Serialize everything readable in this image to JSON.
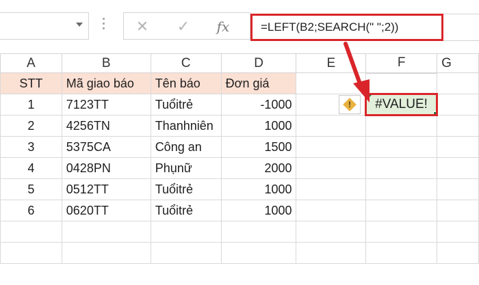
{
  "formula_bar": {
    "name_box_value": "",
    "cancel_icon": "✕",
    "enter_icon": "✓",
    "insert_function_label": "fx",
    "formula": "=LEFT(B2;SEARCH(\" \";2))"
  },
  "columns": [
    "A",
    "B",
    "C",
    "D",
    "E",
    "F",
    "G"
  ],
  "header_row": {
    "stt": "STT",
    "ma": "Mã giao báo",
    "ten": "Tên báo",
    "don_gia": "Đơn giá"
  },
  "rows": [
    {
      "stt": "1",
      "ma": "7123TT",
      "ten": "Tuổitrẻ",
      "don_gia": "-1000"
    },
    {
      "stt": "2",
      "ma": "4256TN",
      "ten": "Thanhniên",
      "don_gia": "1000"
    },
    {
      "stt": "3",
      "ma": "5375CA",
      "ten": "Công an",
      "don_gia": "1500"
    },
    {
      "stt": "4",
      "ma": "0428PN",
      "ten": "Phụnữ",
      "don_gia": "2000"
    },
    {
      "stt": "5",
      "ma": "0512TT",
      "ten": "Tuổitrẻ",
      "don_gia": "1000"
    },
    {
      "stt": "6",
      "ma": "0620TT",
      "ten": "Tuổitrẻ",
      "don_gia": "1000"
    }
  ],
  "result_cell": "#VALUE!",
  "error_indicator_icon": "warning-icon",
  "colors": {
    "header_fill": "#fbe0d4",
    "result_fill": "#e2efda",
    "highlight_red": "#d9252a",
    "excel_green": "#217346"
  }
}
